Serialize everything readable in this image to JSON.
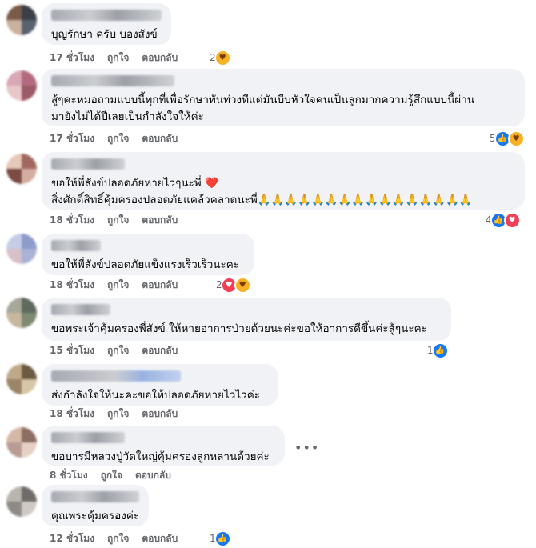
{
  "comments": [
    {
      "lines": [
        "บุญรักษา ครับ บองสังข์"
      ],
      "time": "17 ชั่วโมง",
      "like": "ถูกใจ",
      "reply": "ตอบกลับ",
      "reaction_count": "2",
      "reactions": [
        "care"
      ]
    },
    {
      "lines": [
        "สู้ๆคะหมอถามแบบนี้ทุกที่เพื่อรักษาทันท่วงทีแต่มันบีบหัวใจคนเป็นลูกมากความรู้สึกแบบนี้ผ่าน",
        "มายังไม่ได้ปีเลยเป็นกำลังใจให้ค่ะ"
      ],
      "time": "17 ชั่วโมง",
      "like": "ถูกใจ",
      "reply": "ตอบกลับ",
      "reaction_count": "5",
      "reactions": [
        "like",
        "care"
      ]
    },
    {
      "lines": [
        "ขอให้พี่สังข์ปลอดภัยหายไวๆนะพี่ ❤️",
        "สิ่งศักดิ์สิทธิ์คุ้มครองปลอดภัยแคล้วคลาดนะพี่🙏🙏🙏🙏🙏🙏🙏🙏🙏🙏🙏🙏🙏🙏🙏🙏"
      ],
      "time": "18 ชั่วโมง",
      "like": "ถูกใจ",
      "reply": "ตอบกลับ",
      "reaction_count": "4",
      "reactions": [
        "like",
        "heart"
      ]
    },
    {
      "lines": [
        "ขอให้พี่สังข์ปลอดภัยแข็งแรงเร็วเร็วนะคะ"
      ],
      "time": "18 ชั่วโมง",
      "like": "ถูกใจ",
      "reply": "ตอบกลับ",
      "reaction_count": "2",
      "reactions": [
        "heart",
        "care"
      ]
    },
    {
      "lines": [
        "ขอพระเจ้าคุ้มครองพี่สังข์ ให้หายอาการป่วยด้วยนะค่ะขอให้อาการดีขึ้นค่ะสู้ๆนะคะ"
      ],
      "time": "15 ชั่วโมง",
      "like": "ถูกใจ",
      "reply": "ตอบกลับ",
      "reaction_count": "1",
      "reactions": [
        "like"
      ]
    },
    {
      "lines": [
        "ส่งกำลังใจให้นะคะขอให้ปลอดภัยหายไวไวค่ะ"
      ],
      "time": "18 ชั่วโมง",
      "like": "ถูกใจ",
      "reply": "ตอบกลับ",
      "reaction_count": "",
      "reactions": []
    },
    {
      "lines": [
        "ขอบารมีหลวงปู่วัดใหญ่คุ้มครองลูกหลานด้วยค่ะ"
      ],
      "time": "8 ชั่วโมง",
      "like": "ถูกใจ",
      "reply": "ตอบกลับ",
      "reaction_count": "",
      "reactions": []
    },
    {
      "lines": [
        "คุณพระคุ้มครองค่ะ"
      ],
      "time": "12 ชั่วโมง",
      "like": "ถูกใจ",
      "reply": "ตอบกลับ",
      "reaction_count": "1",
      "reactions": [
        "like"
      ]
    }
  ],
  "more_icon": "more-options-ellipsis",
  "colors": {
    "like": "#1877f2",
    "heart": "#f33e58",
    "care": "#f7b125",
    "bubble": "#f0f2f5",
    "meta": "#65676b"
  }
}
